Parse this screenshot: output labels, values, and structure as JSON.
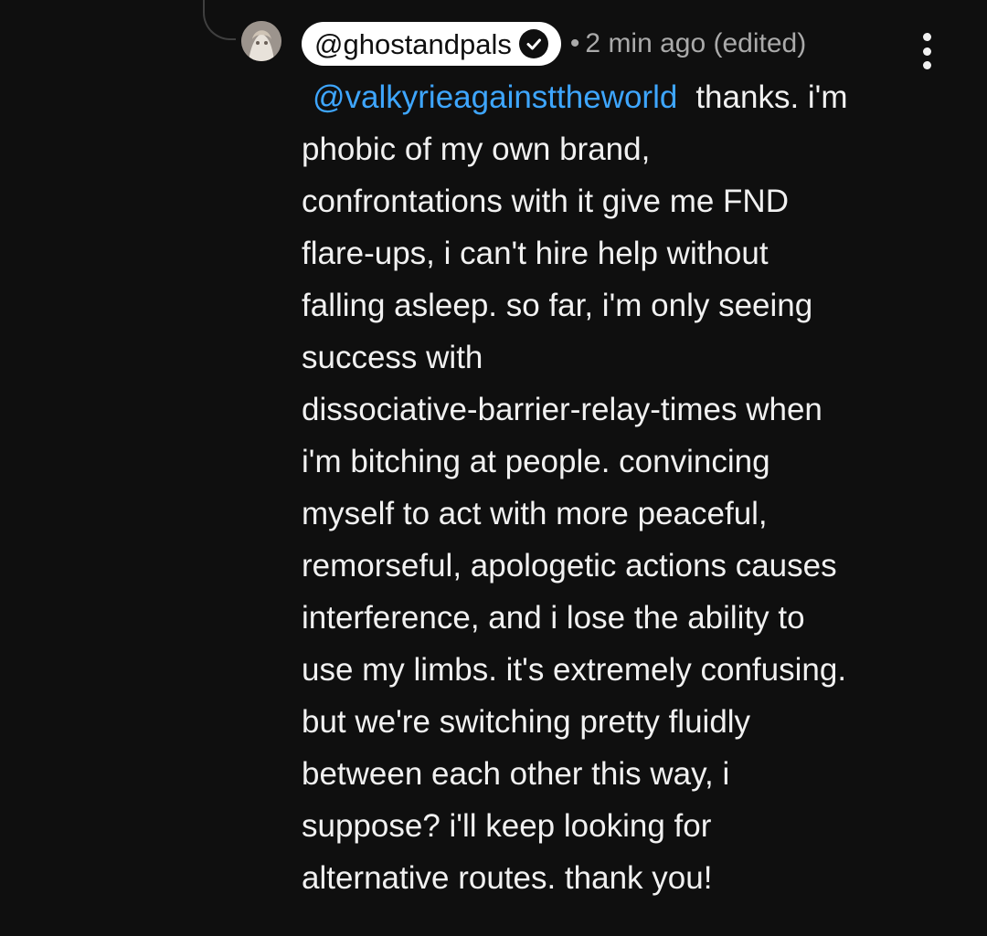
{
  "comment": {
    "author": "@ghostandpals",
    "verified_icon": "check-circle-icon",
    "separator": "•",
    "timestamp": "2 min ago (edited)",
    "mention": "@valkyrieagainsttheworld",
    "text": "thanks. i'm\nphobic of my own brand,\nconfrontations with it give me FND\nflare-ups, i can't hire help without\nfalling asleep. so far, i'm only seeing\nsuccess with\ndissociative-barrier-relay-times when\ni'm bitching at people. convincing\nmyself to act with more peaceful,\nremorseful, apologetic actions causes\ninterference, and i lose the ability to\nuse my limbs. it's extremely confusing.\nbut we're switching pretty fluidly\nbetween each other this way, i\nsuppose? i'll keep looking for\nalternative routes. thank you!"
  },
  "icons": {
    "more": "more-vertical-icon",
    "avatar": "avatar"
  },
  "colors": {
    "background": "#0f0f0f",
    "text": "#f1f1f1",
    "meta": "#aaaaaa",
    "mention": "#3ea6ff",
    "pill": "#ffffff"
  }
}
